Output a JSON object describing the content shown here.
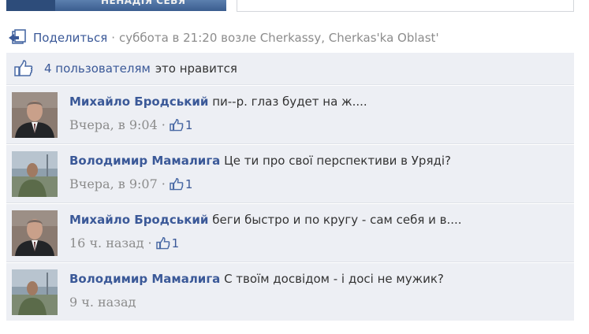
{
  "top_banner": {
    "text": "НЕНАДІЯ СЕБЯ"
  },
  "share_row": {
    "share_link": "Поделиться",
    "separator": "·",
    "meta": "суббота в 21:20 возле Cherkassy, Cherkas'ka Oblast'"
  },
  "likes": {
    "link": "4 пользователям",
    "text": "это нравится"
  },
  "comments": [
    {
      "author": "Михайло Бродський",
      "text": "пи--р. глаз будет на ж....",
      "time": "Вчера, в 9:04",
      "likes": "1"
    },
    {
      "author": "Володимир Мамалига",
      "text": "Це ти про свої перспективи в Уряді?",
      "time": "Вчера, в 9:07",
      "likes": "1"
    },
    {
      "author": "Михайло Бродський",
      "text": "беги быстро и по кругу - сам себя и в....",
      "time": "16 ч. назад",
      "likes": "1"
    },
    {
      "author": "Володимир Мамалига",
      "text": "С твоїм досвідом - і досі не мужик?",
      "time": "9 ч. назад",
      "likes": ""
    }
  ],
  "colors": {
    "link": "#3b5998",
    "panel_bg": "#edeff4",
    "meta": "#8c8c8c"
  },
  "icons": {
    "share": "share-icon",
    "like": "thumbs-up-icon"
  }
}
